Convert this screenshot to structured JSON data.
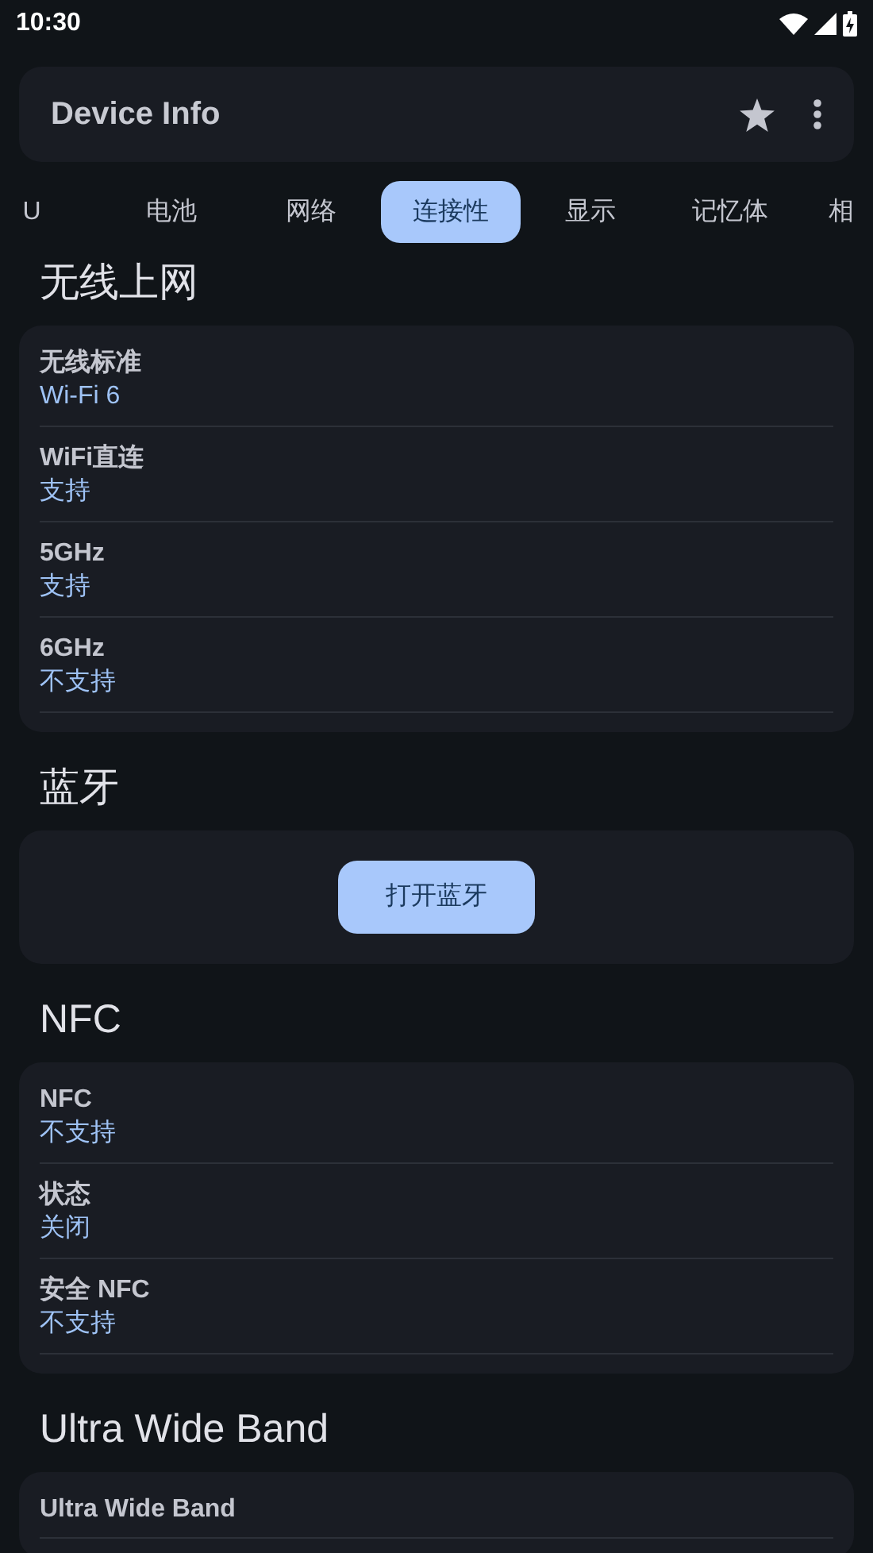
{
  "status_bar": {
    "time": "10:30"
  },
  "app_bar": {
    "title": "Device Info"
  },
  "tabs": [
    {
      "label": "U",
      "selected": false
    },
    {
      "label": "电池",
      "selected": false
    },
    {
      "label": "网络",
      "selected": false
    },
    {
      "label": "连接性",
      "selected": true
    },
    {
      "label": "显示",
      "selected": false
    },
    {
      "label": "记忆体",
      "selected": false
    },
    {
      "label": "相",
      "selected": false
    }
  ],
  "sections": [
    {
      "title": "无线上网",
      "kind": "list",
      "rows": [
        {
          "label": "无线标准",
          "value": "Wi-Fi 6"
        },
        {
          "label": "WiFi直连",
          "value": "支持"
        },
        {
          "label": "5GHz",
          "value": "支持"
        },
        {
          "label": "6GHz",
          "value": "不支持"
        }
      ]
    },
    {
      "title": "蓝牙",
      "kind": "button",
      "button": "打开蓝牙"
    },
    {
      "title": "NFC",
      "kind": "list",
      "rows": [
        {
          "label": "NFC",
          "value": "不支持"
        },
        {
          "label": "状态",
          "value": "关闭"
        },
        {
          "label": "安全 NFC",
          "value": "不支持"
        }
      ]
    },
    {
      "title": "Ultra Wide Band",
      "kind": "list",
      "rows": [
        {
          "label": "Ultra Wide Band"
        }
      ]
    }
  ]
}
